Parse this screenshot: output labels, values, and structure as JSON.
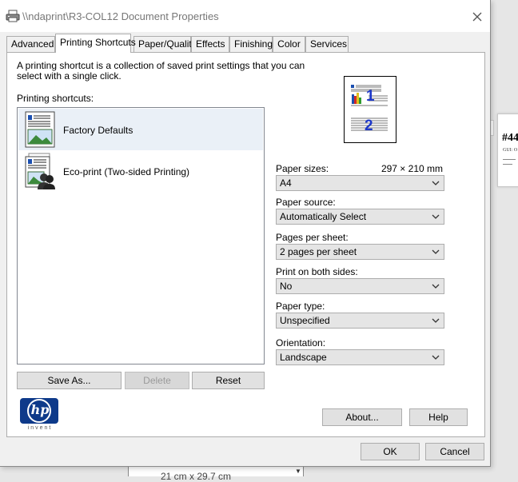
{
  "title": "\\\\ndaprint\\R3-COL12 Document Properties",
  "tabs": [
    {
      "label": "Advanced"
    },
    {
      "label": "Printing Shortcuts"
    },
    {
      "label": "Paper/Quality"
    },
    {
      "label": "Effects"
    },
    {
      "label": "Finishing"
    },
    {
      "label": "Color"
    },
    {
      "label": "Services"
    }
  ],
  "active_tab": "Printing Shortcuts",
  "description": "A printing shortcut is a collection of saved print settings that you can select with a single click.",
  "shortcuts_label": "Printing shortcuts:",
  "shortcuts": [
    {
      "label": "Factory Defaults",
      "selected": true,
      "icon": "document-landscape-icon"
    },
    {
      "label": "Eco-print (Two-sided Printing)",
      "selected": false,
      "icon": "document-users-icon"
    }
  ],
  "buttons": {
    "save_as": "Save As...",
    "delete": "Delete",
    "reset": "Reset",
    "about": "About...",
    "help": "Help",
    "ok": "OK",
    "cancel": "Cancel"
  },
  "preview": {
    "page1": "1",
    "page2": "2"
  },
  "fields": {
    "paper_sizes": {
      "label": "Paper sizes:",
      "extra": "297 × 210 mm",
      "value": "A4"
    },
    "paper_source": {
      "label": "Paper source:",
      "value": "Automatically Select"
    },
    "pages_per_sheet": {
      "label": "Pages per sheet:",
      "value": "2 pages per sheet"
    },
    "print_both_sides": {
      "label": "Print on both sides:",
      "value": "No"
    },
    "paper_type": {
      "label": "Paper type:",
      "value": "Unspecified"
    },
    "orientation": {
      "label": "Orientation:",
      "value": "Landscape"
    }
  },
  "logo": {
    "text": "hp",
    "tagline": "invent"
  },
  "background": {
    "doc_heading": "#44",
    "doc_sub": "GUI: O",
    "strip_text": "21 cm x 29.7 cm"
  },
  "colors": {
    "accent_blue": "#0e3a8a",
    "selection": "#eaf0f7",
    "preview_number": "#1c37c9"
  }
}
